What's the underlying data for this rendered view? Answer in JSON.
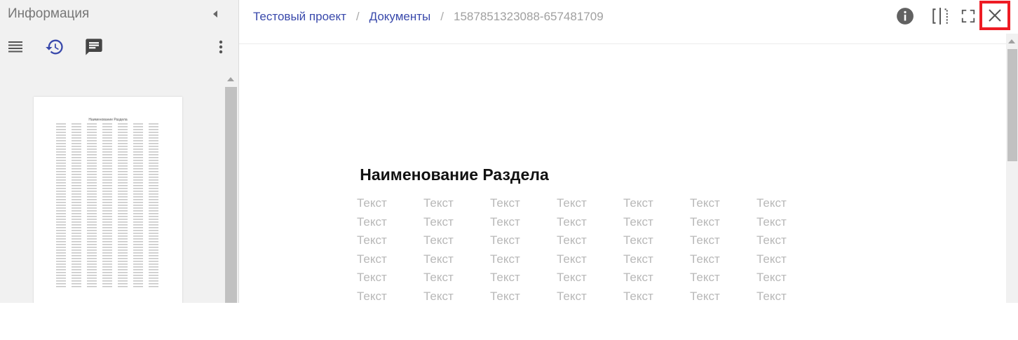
{
  "sidebar": {
    "title": "Информация",
    "icons": [
      "list-icon",
      "history-icon",
      "comment-icon",
      "more-vertical-icon"
    ],
    "thumbnail_title": "Наименование Раздела"
  },
  "breadcrumb": {
    "project": "Тестовый проект",
    "folder": "Документы",
    "separator": "/",
    "current": "1587851323088-657481709"
  },
  "header_icons": [
    "info-icon",
    "split-view-icon",
    "fullscreen-icon",
    "close-icon"
  ],
  "document": {
    "title": "Наименование Раздела",
    "rows": [
      [
        "Текст",
        "Текст",
        "Текст",
        "Текст",
        "Текст",
        "Текст",
        "Текст"
      ],
      [
        "Текст",
        "Текст",
        "Текст",
        "Текст",
        "Текст",
        "Текст",
        "Текст"
      ],
      [
        "Текст",
        "Текст",
        "Текст",
        "Текст",
        "Текст",
        "Текст",
        "Текст"
      ],
      [
        "Текст",
        "Текст",
        "Текст",
        "Текст",
        "Текст",
        "Текст",
        "Текст"
      ],
      [
        "Текст",
        "Текст",
        "Текст",
        "Текст",
        "Текст",
        "Текст",
        "Текст"
      ],
      [
        "Текст",
        "Текст",
        "Текст",
        "Текст",
        "Текст",
        "Текст",
        "Текст"
      ]
    ]
  },
  "colors": {
    "link": "#3949ab",
    "highlight": "#ee1c24",
    "muted_text": "#b8b8b8"
  }
}
